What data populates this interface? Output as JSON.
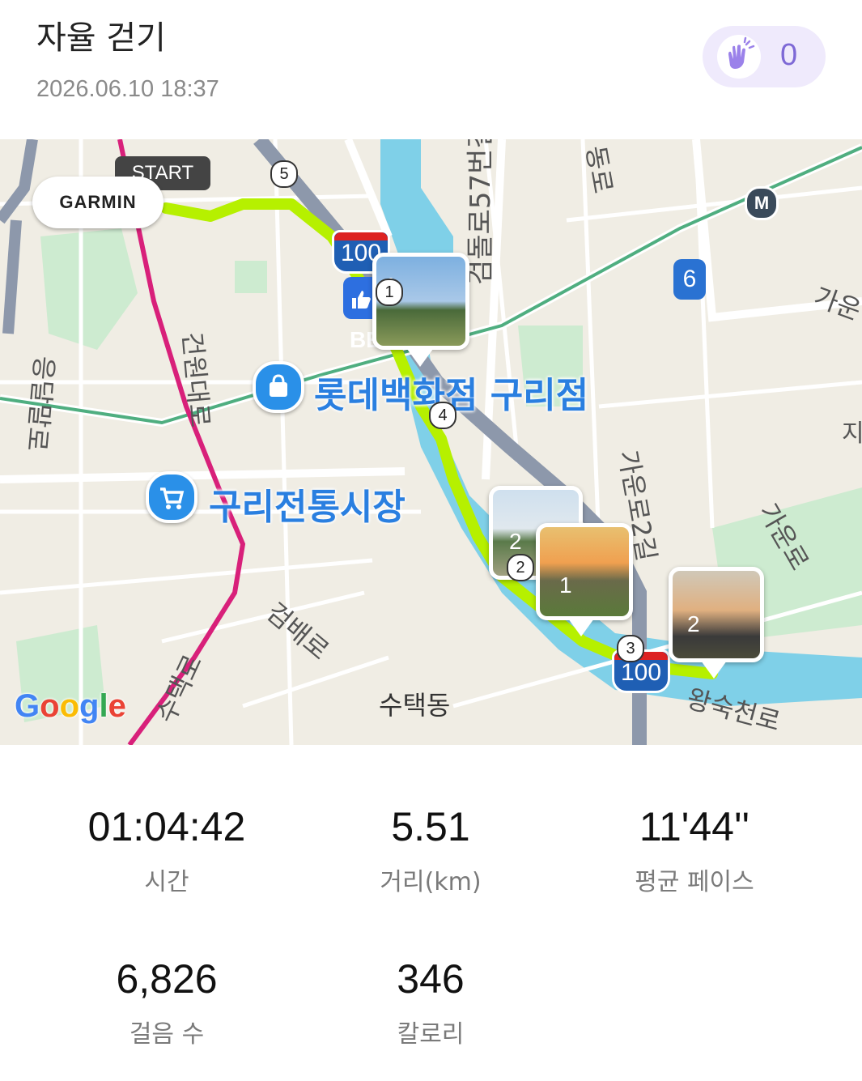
{
  "header": {
    "title": "자율 걷기",
    "datetime": "2026.06.10 18:37",
    "clap_count": "0"
  },
  "map": {
    "start_label": "START",
    "garmin_label": "GARMIN",
    "best_label": "BEST",
    "highway_number": "100",
    "metro_label": "M",
    "route_number": "6",
    "google_logo": "Google",
    "poi": {
      "lotte": "롯데백화점 구리점",
      "market": "구리전통시장"
    },
    "waypoints": [
      "1",
      "2",
      "3",
      "4",
      "5"
    ],
    "photo_counts": {
      "a": "1",
      "b": "2",
      "c": "1",
      "d": "2"
    },
    "labels": {
      "road_57": "검돌로57번길",
      "nongro": "동로",
      "gaun_right": "가운",
      "geonwon": "건원대로",
      "eungdam": "응달말로",
      "gaunro2gil": "가운로2길",
      "gaunro": "가운로",
      "geombaero": "검배로",
      "sutaekdong": "수택동",
      "wangsukcheon": "왕숙천로",
      "sutaek_road": "수택로",
      "ji": "지"
    },
    "route_color": "#b6f000",
    "water_color": "#7fd0e8",
    "park_color": "#cdebd0"
  },
  "stats": {
    "time": {
      "value": "01:04:42",
      "label": "시간"
    },
    "distance": {
      "value": "5.51",
      "label": "거리(km)"
    },
    "pace": {
      "value": "11'44''",
      "label": "평균 페이스"
    },
    "steps": {
      "value": "6,826",
      "label": "걸음 수"
    },
    "calories": {
      "value": "346",
      "label": "칼로리"
    }
  }
}
